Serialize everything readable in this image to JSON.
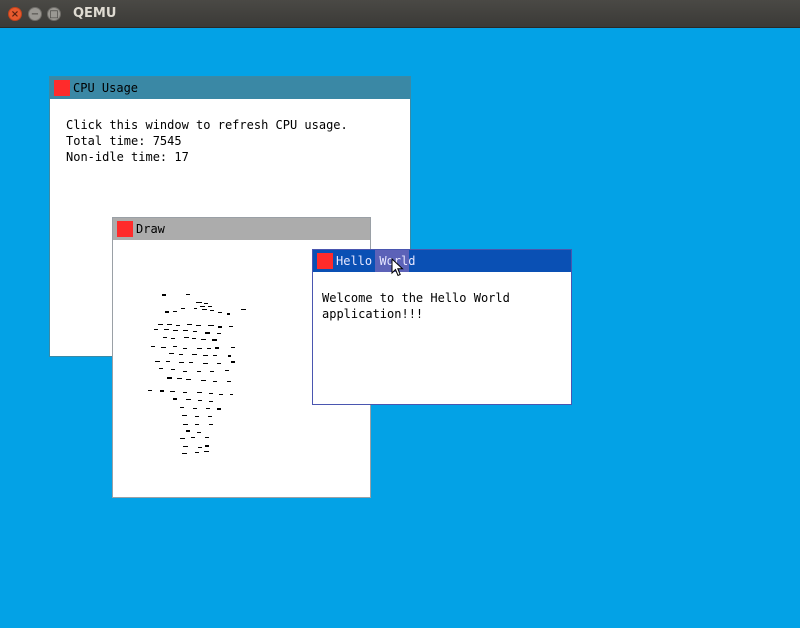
{
  "host_window": {
    "title": "QEMU",
    "close_glyph": "×",
    "minimize_glyph": "−",
    "maximize_glyph": "□"
  },
  "windows": {
    "cpu_usage": {
      "title": "CPU Usage",
      "lines": [
        "Click this window to refresh CPU usage.",
        "Total time: 7545",
        "Non-idle time: 17"
      ]
    },
    "draw": {
      "title": "Draw"
    },
    "hello_world": {
      "title": "Hello World",
      "lines": [
        "Welcome to the Hello World",
        "application!!!"
      ]
    }
  },
  "colors": {
    "desktop_background": "#03a2e6",
    "close_box": "#ff2b2b",
    "cpu_titlebar": "#3a88a5",
    "draw_titlebar": "#acacac",
    "hello_titlebar": "#0a50b4"
  },
  "icons": {
    "pointer": "arrow-cursor-icon"
  }
}
